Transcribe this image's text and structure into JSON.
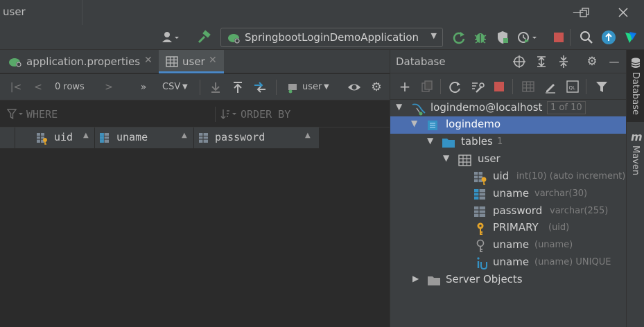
{
  "window": {
    "title": "user"
  },
  "toolbar": {
    "run_config": "SpringbootLoginDemoApplication"
  },
  "tabs": [
    {
      "label": "application.properties",
      "active": false
    },
    {
      "label": "user",
      "active": true
    }
  ],
  "grid_toolbar": {
    "rows": "0 rows",
    "export_format": "CSV",
    "session": "user"
  },
  "filters": {
    "where": "WHERE",
    "order_by": "ORDER BY"
  },
  "columns": [
    {
      "name": "uid",
      "icon": "key-column-icon"
    },
    {
      "name": "uname",
      "icon": "column-icon"
    },
    {
      "name": "password",
      "icon": "column-icon"
    }
  ],
  "db_panel": {
    "title": "Database",
    "tree": [
      {
        "label": "logindemo@localhost",
        "extra": "1 of 10",
        "level": 0,
        "expanded": true
      },
      {
        "label": "logindemo",
        "extra": "",
        "level": 1,
        "expanded": true,
        "selected": true
      },
      {
        "label": "tables",
        "extra": "1",
        "level": 2,
        "expanded": true
      },
      {
        "label": "user",
        "extra": "",
        "level": 3,
        "expanded": true
      },
      {
        "label": "uid",
        "extra": "int(10) (auto increment)",
        "level": 4
      },
      {
        "label": "uname",
        "extra": "varchar(30)",
        "level": 4
      },
      {
        "label": "password",
        "extra": "varchar(255)",
        "level": 4
      },
      {
        "label": "PRIMARY",
        "extra": "(uid)",
        "level": 4
      },
      {
        "label": "uname",
        "extra": "(uname)",
        "level": 4
      },
      {
        "label": "uname",
        "extra": "(uname) UNIQUE",
        "level": 4
      },
      {
        "label": "Server Objects",
        "extra": "",
        "level": 1,
        "expanded": false
      }
    ]
  },
  "sidebar": {
    "tabs": [
      "Database",
      "Maven"
    ]
  },
  "colors": {
    "accent": "#4a88c7",
    "selection": "#4b6eaf",
    "green": "#59a869",
    "red": "#c75450"
  }
}
